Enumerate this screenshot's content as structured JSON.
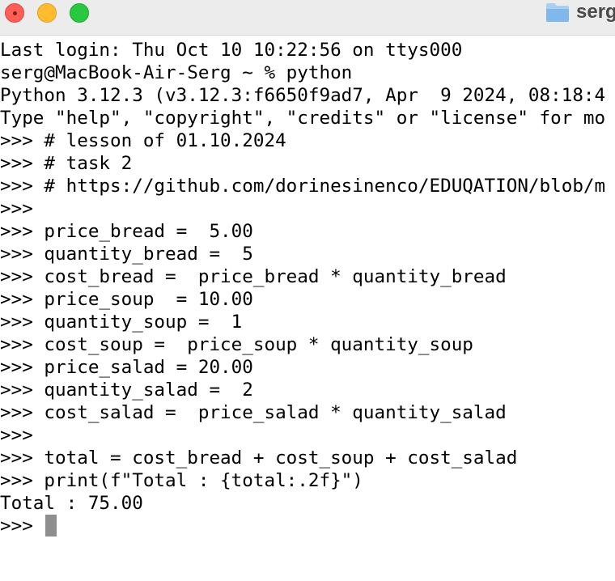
{
  "window": {
    "title": "serg",
    "title_icon": "folder-icon",
    "accent_colors": {
      "close": "#ff5f57",
      "minimize": "#febc2e",
      "maximize": "#28c840"
    }
  },
  "terminal": {
    "lines": [
      "Last login: Thu Oct 10 10:22:56 on ttys000",
      "serg@MacBook-Air-Serg ~ % python",
      "Python 3.12.3 (v3.12.3:f6650f9ad7, Apr  9 2024, 08:18:4",
      "Type \"help\", \"copyright\", \"credits\" or \"license\" for mo",
      ">>> # lesson of 01.10.2024",
      ">>> # task 2",
      ">>> # https://github.com/dorinesinenco/EDUQATION/blob/m",
      ">>>",
      ">>> price_bread =  5.00",
      ">>> quantity_bread =  5",
      ">>> cost_bread =  price_bread * quantity_bread",
      ">>> price_soup  = 10.00",
      ">>> quantity_soup =  1",
      ">>> cost_soup =  price_soup * quantity_soup",
      ">>> price_salad = 20.00",
      ">>> quantity_salad =  2",
      ">>> cost_salad =  price_salad * quantity_salad",
      ">>>",
      ">>> total = cost_bread + cost_soup + cost_salad",
      ">>> print(f\"Total : {total:.2f}\")",
      "Total : 75.00",
      ">>> "
    ]
  }
}
